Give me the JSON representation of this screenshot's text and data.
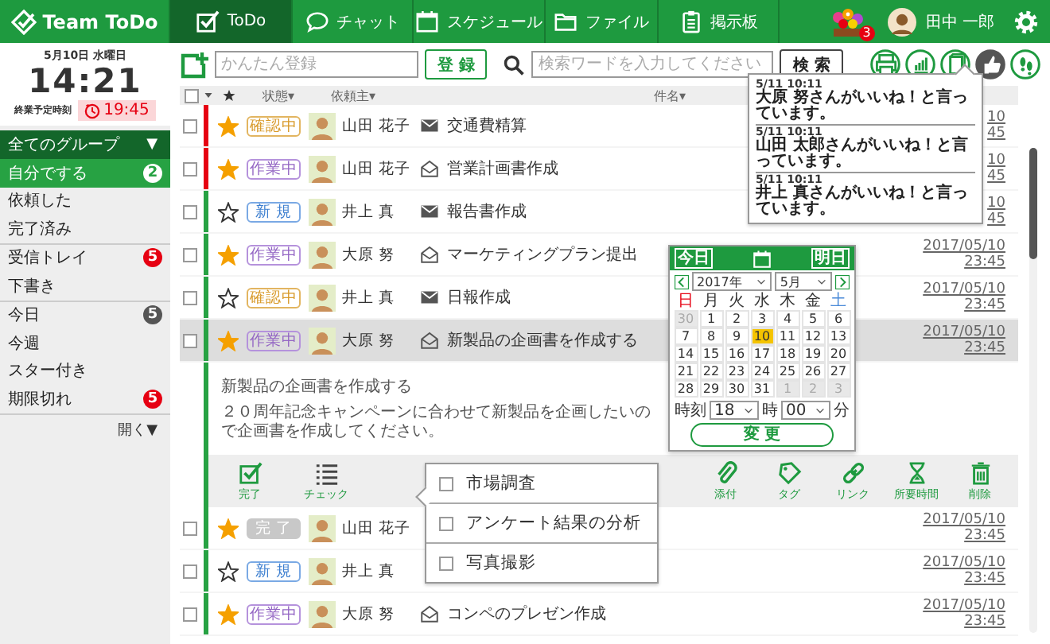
{
  "header": {
    "logo": "Team ToDo",
    "tabs": [
      {
        "label": "ToDo",
        "selected": true
      },
      {
        "label": "チャット",
        "selected": false
      },
      {
        "label": "スケジュール",
        "selected": false
      },
      {
        "label": "ファイル",
        "selected": false
      },
      {
        "label": "掲示板",
        "selected": false
      }
    ],
    "notification_count": "3",
    "user_name": "田中 一郎"
  },
  "sidebar": {
    "date": "5月10日 水曜日",
    "time": "14:21",
    "end_label": "終業予定時刻",
    "end_time": "19:45",
    "group": {
      "label": "全てのグループ",
      "caret": "▼"
    },
    "sections": [
      {
        "items": [
          {
            "label": "自分でする",
            "selected": true,
            "count": "2",
            "color": "#ffffff"
          },
          {
            "label": "依頼した",
            "selected": false
          },
          {
            "label": "完了済み",
            "selected": false
          }
        ]
      },
      {
        "items": [
          {
            "label": "受信トレイ",
            "selected": false,
            "count": "5",
            "color": "#e60012"
          },
          {
            "label": "下書き",
            "selected": false
          }
        ]
      },
      {
        "items": [
          {
            "label": "今日",
            "selected": false,
            "count": "5",
            "color": "#555555"
          },
          {
            "label": "今週",
            "selected": false
          },
          {
            "label": "スター付き",
            "selected": false
          },
          {
            "label": "期限切れ",
            "selected": false,
            "count": "5",
            "color": "#e60012"
          }
        ]
      }
    ],
    "more": "開く▼"
  },
  "toolbar": {
    "quick_add": {
      "placeholder": "かんたん登録"
    },
    "add_button": "登 録",
    "search": {
      "placeholder": "検索ワードを入力してください"
    },
    "search_button": "検 索",
    "tools": [
      {
        "kind": "printer",
        "selected": false
      },
      {
        "kind": "chart",
        "selected": false
      },
      {
        "kind": "book",
        "selected": false
      },
      {
        "kind": "like",
        "selected": true
      },
      {
        "kind": "footprints",
        "selected": false
      }
    ]
  },
  "likes_popup": {
    "items": [
      {
        "time": "5/11 10:11",
        "text": "大原 努さんがいいね！と言っています。"
      },
      {
        "time": "5/11 10:11",
        "text": "山田 太郎さんがいいね！と言っています。"
      },
      {
        "time": "5/11 10:11",
        "text": "井上 真さんがいいね！と言っています。"
      }
    ]
  },
  "table": {
    "select_all_checked": false,
    "columns": [
      "状態▾",
      "依頼主▾",
      "件名▾"
    ],
    "rows": [
      {
        "checked": false,
        "starred": true,
        "status": {
          "label": "確認中",
          "kind": "confirming"
        },
        "requester": "山田 花子",
        "read": false,
        "title": "交通費精算",
        "date": "10",
        "time": "45",
        "color": "#e60012",
        "selected": false
      },
      {
        "checked": false,
        "starred": true,
        "status": {
          "label": "作業中",
          "kind": "working"
        },
        "requester": "山田 花子",
        "read": true,
        "title": "営業計画書作成",
        "date": "10",
        "time": "45",
        "color": "#e60012",
        "selected": false
      },
      {
        "checked": false,
        "starred": false,
        "status": {
          "label": "新 規",
          "kind": "new"
        },
        "requester": "井上 真",
        "read": false,
        "title": "報告書作成",
        "date": "10",
        "time": "45",
        "color": "#27a243",
        "selected": false
      },
      {
        "checked": false,
        "starred": true,
        "status": {
          "label": "作業中",
          "kind": "working"
        },
        "requester": "大原 努",
        "read": true,
        "title": "マーケティングプラン提出",
        "date": "2017/05/10",
        "time": "23:45",
        "color": "#27a243",
        "selected": false
      },
      {
        "checked": false,
        "starred": false,
        "status": {
          "label": "確認中",
          "kind": "confirming"
        },
        "requester": "井上 真",
        "read": false,
        "title": "日報作成",
        "date": "2017/05/10",
        "time": "23:45",
        "color": "#27a243",
        "selected": false
      },
      {
        "checked": false,
        "starred": true,
        "status": {
          "label": "作業中",
          "kind": "working"
        },
        "requester": "大原 努",
        "read": true,
        "title": "新製品の企画書を作成する",
        "date": "2017/05/10",
        "time": "23:45",
        "color": "#27a243",
        "selected": true,
        "expanded": true,
        "detail": {
          "title": "新製品の企画書を作成する",
          "body": "２０周年記念キャンペーンに合わせて新製品を企画したいので企画書を作成してください。",
          "actions": [
            {
              "kind": "done",
              "label": "完了"
            },
            {
              "kind": "checklist",
              "label": "チェック"
            },
            {
              "kind": "attach",
              "label": "添付"
            },
            {
              "kind": "tag",
              "label": "タグ"
            },
            {
              "kind": "link",
              "label": "リンク"
            },
            {
              "kind": "duration",
              "label": "所要時間"
            },
            {
              "kind": "delete",
              "label": "削除"
            }
          ]
        }
      },
      {
        "checked": false,
        "starred": true,
        "status": {
          "label": "完 了",
          "kind": "done"
        },
        "requester": "山田 花子",
        "date": "2017/05/10",
        "time": "23:45",
        "color": "#27a243",
        "selected": false
      },
      {
        "checked": false,
        "starred": false,
        "status": {
          "label": "新 規",
          "kind": "new"
        },
        "requester": "井上 真",
        "date": "2017/05/10",
        "time": "23:45",
        "color": "#27a243",
        "selected": false
      },
      {
        "checked": false,
        "starred": true,
        "status": {
          "label": "作業中",
          "kind": "working"
        },
        "requester": "大原 努",
        "read": true,
        "title": "コンペのプレゼン作成",
        "date": "2017/05/10",
        "time": "23:45",
        "color": "#27a243",
        "selected": false
      }
    ]
  },
  "checklist": {
    "items": [
      {
        "label": "市場調査",
        "checked": false
      },
      {
        "label": "アンケート結果の分析",
        "checked": false
      },
      {
        "label": "写真撮影",
        "checked": false
      }
    ]
  },
  "date_picker": {
    "today_button": "今日",
    "tomorrow_button": "明日",
    "year": "2017年",
    "month": "5月",
    "weekdays": [
      {
        "label": "日",
        "color": "#e60012"
      },
      {
        "label": "月",
        "color": "#333333"
      },
      {
        "label": "火",
        "color": "#333333"
      },
      {
        "label": "水",
        "color": "#333333"
      },
      {
        "label": "木",
        "color": "#333333"
      },
      {
        "label": "金",
        "color": "#333333"
      },
      {
        "label": "土",
        "color": "#4a8ad8"
      }
    ],
    "days": [
      {
        "label": "30",
        "muted": true,
        "selected": false
      },
      {
        "label": "1",
        "muted": false,
        "selected": false
      },
      {
        "label": "2",
        "muted": false,
        "selected": false
      },
      {
        "label": "3",
        "muted": false,
        "selected": false
      },
      {
        "label": "4",
        "muted": false,
        "selected": false
      },
      {
        "label": "5",
        "muted": false,
        "selected": false
      },
      {
        "label": "6",
        "muted": false,
        "selected": false
      },
      {
        "label": "7",
        "muted": false,
        "selected": false
      },
      {
        "label": "8",
        "muted": false,
        "selected": false
      },
      {
        "label": "9",
        "muted": false,
        "selected": false
      },
      {
        "label": "10",
        "muted": false,
        "selected": true
      },
      {
        "label": "11",
        "muted": false,
        "selected": false
      },
      {
        "label": "12",
        "muted": false,
        "selected": false
      },
      {
        "label": "13",
        "muted": false,
        "selected": false
      },
      {
        "label": "14",
        "muted": false,
        "selected": false
      },
      {
        "label": "15",
        "muted": false,
        "selected": false
      },
      {
        "label": "16",
        "muted": false,
        "selected": false
      },
      {
        "label": "17",
        "muted": false,
        "selected": false
      },
      {
        "label": "18",
        "muted": false,
        "selected": false
      },
      {
        "label": "19",
        "muted": false,
        "selected": false
      },
      {
        "label": "20",
        "muted": false,
        "selected": false
      },
      {
        "label": "21",
        "muted": false,
        "selected": false
      },
      {
        "label": "22",
        "muted": false,
        "selected": false
      },
      {
        "label": "23",
        "muted": false,
        "selected": false
      },
      {
        "label": "24",
        "muted": false,
        "selected": false
      },
      {
        "label": "25",
        "muted": false,
        "selected": false
      },
      {
        "label": "26",
        "muted": false,
        "selected": false
      },
      {
        "label": "27",
        "muted": false,
        "selected": false
      },
      {
        "label": "28",
        "muted": false,
        "selected": false
      },
      {
        "label": "29",
        "muted": false,
        "selected": false
      },
      {
        "label": "30",
        "muted": false,
        "selected": false
      },
      {
        "label": "31",
        "muted": false,
        "selected": false
      },
      {
        "label": "1",
        "muted": true,
        "selected": false
      },
      {
        "label": "2",
        "muted": true,
        "selected": false
      },
      {
        "label": "3",
        "muted": true,
        "selected": false
      }
    ],
    "hour_label": "時刻",
    "hour": "18",
    "hour_unit": "時",
    "minute": "00",
    "minute_unit": "分",
    "apply_button": "変 更"
  }
}
